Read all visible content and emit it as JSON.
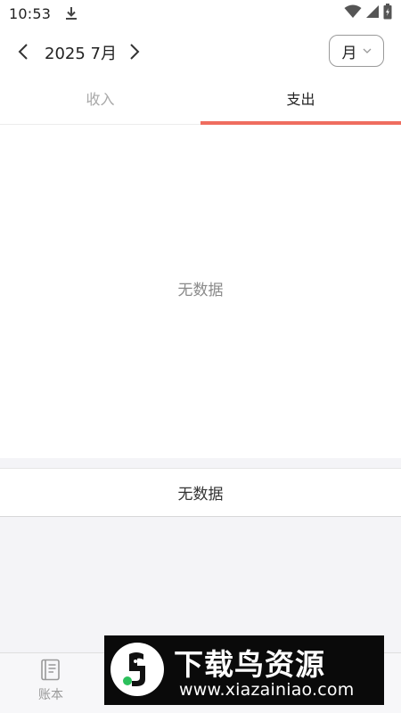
{
  "status_bar": {
    "time": "10:53",
    "icons": [
      "download-icon",
      "wifi-icon",
      "signal-icon",
      "battery-icon"
    ]
  },
  "header": {
    "month_label": "2025 7月",
    "period_select": {
      "selected": "月"
    }
  },
  "tabs": [
    {
      "label": "收入",
      "active": false
    },
    {
      "label": "支出",
      "active": true
    }
  ],
  "chart": {
    "empty_text": "无数据"
  },
  "list": {
    "empty_text": "无数据"
  },
  "bottom_nav": {
    "items": [
      {
        "label": "账本",
        "icon": "book-icon"
      }
    ]
  },
  "watermark": {
    "title": "下载鸟资源",
    "url": "www.xiazainiao.com"
  },
  "colors": {
    "accent": "#ef6d5f",
    "tab_inactive": "#a8a8a8",
    "background_gray": "#f4f4f7"
  }
}
